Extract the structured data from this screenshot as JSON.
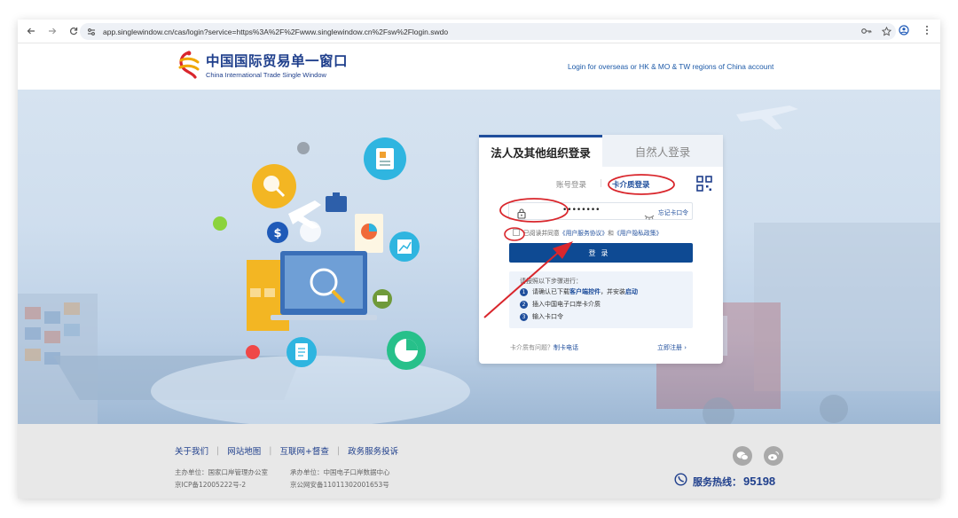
{
  "browser": {
    "url": "app.singlewindow.cn/cas/login?service=https%3A%2F%2Fwww.singlewindow.cn%2Fsw%2Flogin.swdo",
    "icons": [
      "back-arrow-icon",
      "forward-arrow-icon",
      "reload-icon",
      "site-settings-icon",
      "password-key-icon",
      "star-icon",
      "profile-icon",
      "menu-dots-icon"
    ]
  },
  "header": {
    "logo_cn": "中国国际贸易单一窗口",
    "logo_en": "China International Trade Single Window",
    "overseas_link": "Login for overseas or HK & MO & TW regions of China account"
  },
  "login": {
    "tab_org": "法人及其他组织登录",
    "tab_person": "自然人登录",
    "sub_account": "账号登录",
    "sub_separator": "|",
    "sub_card": "卡介质登录",
    "password_value": "••••••••",
    "forgot": "忘记卡口令",
    "agree_prefix": "已阅读并同意",
    "agree_link1": "《用户服务协议》",
    "agree_and": "和",
    "agree_link2": "《用户隐私政策》",
    "button": "登录",
    "steps_title": "请按照以下步骤进行：",
    "step1_num": "1",
    "step1_a": "请确认已下载",
    "step1_link1": "客户端控件",
    "step1_b": "，并安装",
    "step1_link2": "启动",
    "step2_num": "2",
    "step2": "插入中国电子口岸卡介质",
    "step3_num": "3",
    "step3": "输入卡口令",
    "help_q": "卡介质有问题？",
    "help_link": "制卡电话",
    "register": "立即注册 ›"
  },
  "footer": {
    "nav": [
      "关于我们",
      "网站地图",
      "互联网+督查",
      "政务服务投诉"
    ],
    "host": "主办单位：国家口岸管理办公室",
    "undertake": "承办单位：中国电子口岸数据中心",
    "icp": "京ICP备12005222号-2",
    "police": "京公网安备11011302001653号",
    "hotline_label": "服务热线：",
    "hotline_number": "95198"
  },
  "colors": {
    "brand_blue": "#1f3f8c",
    "button_blue": "#0e4a93",
    "annotation_red": "#d9262c"
  }
}
